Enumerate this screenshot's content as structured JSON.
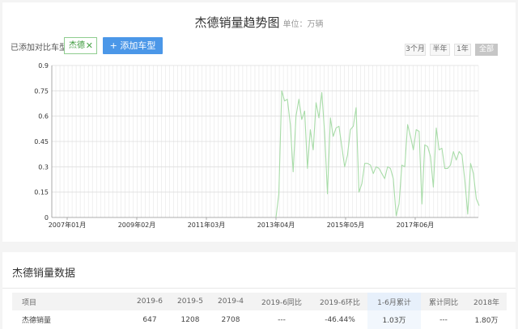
{
  "header": {
    "title": "杰德销量趋势图",
    "unit": "单位：万辆"
  },
  "compare": {
    "label": "已添加对比车型：",
    "tag": "杰德",
    "add_button": "+ 添加车型"
  },
  "ranges": [
    "3个月",
    "半年",
    "1年",
    "全部"
  ],
  "colors": {
    "accent": "#4b97e8",
    "line": "#a8dca8",
    "active_range": "#c6c6c6"
  },
  "chart_data": {
    "type": "line",
    "ylim": [
      0,
      0.9
    ],
    "yticks": [
      "0.9",
      "0.75",
      "0.6",
      "0.45",
      "0.3",
      "0.15",
      "0"
    ],
    "xticks": [
      "2007年01月",
      "2009年02月",
      "2011年03月",
      "2013年04月",
      "2015年05月",
      "2017年06月"
    ],
    "series": [
      {
        "values": [
          0,
          0.14,
          0.75,
          0.69,
          0.7,
          0.55,
          0.27,
          0.6,
          0.7,
          0.58,
          0.63,
          0.29,
          0.52,
          0.4,
          0.68,
          0.59,
          0.74,
          0.5,
          0.14,
          0.59,
          0.48,
          0.53,
          0.54,
          0.42,
          0.3,
          0.37,
          0.52,
          0.54,
          0.65,
          0.15,
          0.2,
          0.32,
          0.32,
          0.31,
          0.26,
          0.3,
          0.29,
          0.26,
          0.23,
          0.3,
          0.29,
          0.23,
          0.01,
          0.08,
          0.31,
          0.3,
          0.55,
          0.48,
          0.4,
          0.52,
          0.51,
          0.08,
          0.43,
          0.42,
          0.36,
          0.18,
          0.53,
          0.4,
          0.41,
          0.29,
          0.29,
          0.31,
          0.39,
          0.34,
          0.39,
          0.37,
          0.22,
          0.02,
          0.32,
          0.26,
          0.11,
          0.07
        ]
      }
    ]
  },
  "section": {
    "title": "杰德销量数据"
  },
  "table": {
    "headers": [
      "项目",
      "2019-6",
      "2019-5",
      "2019-4",
      "2019-6同比",
      "2019-6环比",
      "1-6月累计",
      "累计同比",
      "2018年"
    ],
    "row": [
      "杰德销量",
      "647",
      "1208",
      "2708",
      "---",
      "-46.44%",
      "1.03万",
      "---",
      "1.80万"
    ]
  }
}
